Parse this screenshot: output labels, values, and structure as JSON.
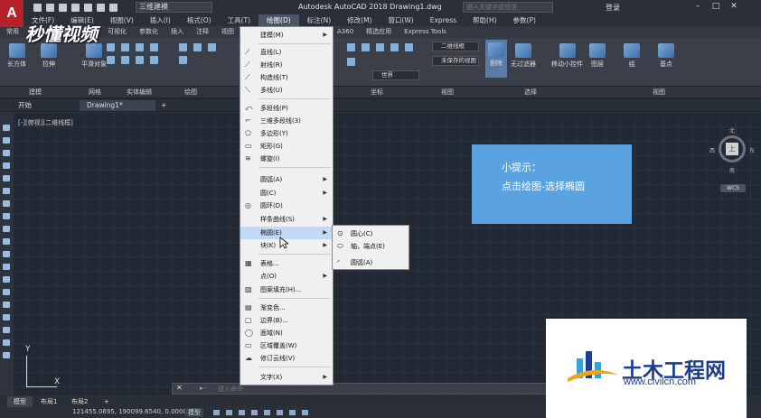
{
  "titlebar": {
    "app_logo": "A",
    "workspace": "三维建模",
    "app_title": "Autodesk AutoCAD 2018    Drawing1.dwg",
    "search_placeholder": "键入关键字或短语",
    "login": "登录"
  },
  "menubar": {
    "items": [
      "文件(F)",
      "编辑(E)",
      "视图(V)",
      "插入(I)",
      "格式(O)",
      "工具(T)",
      "绘图(D)",
      "标注(N)",
      "修改(M)",
      "窗口(W)",
      "Express",
      "帮助(H)",
      "参数(P)"
    ]
  },
  "ribbon_tabs": [
    "常用",
    "实体",
    "曲面",
    "网格",
    "可视化",
    "参数化",
    "插入",
    "注释",
    "视图",
    "A360",
    "精选应用",
    "Express Tools"
  ],
  "ribbon": {
    "buttons": {
      "box": "长方体",
      "extrude": "拉伸",
      "smooth": "平滑对象",
      "delete": "剔除",
      "no_filter": "无过滤器",
      "move_gizmo": "移动小控件",
      "layers": "图层",
      "group": "组",
      "base": "基点"
    },
    "visual_style": "二维线框",
    "view_dropdown": "未保存的视图",
    "ucs_dropdown": "世界",
    "panels": [
      "建模",
      "网格",
      "实体编辑",
      "绘图",
      "坐标",
      "视图",
      "选择",
      "视图"
    ]
  },
  "doc_tabs": [
    "开始",
    "Drawing1*"
  ],
  "viewport_label": "[-][俯视][二维线框]",
  "navcube": {
    "north": "北",
    "south": "南",
    "east": "东",
    "west": "西",
    "face": "上",
    "wcs": "WCS"
  },
  "tip": {
    "title": "小提示：",
    "text": "点击绘图-选择椭圆"
  },
  "draw_menu": {
    "items": [
      {
        "label": "建模(M)",
        "arrow": true,
        "icon": ""
      },
      {
        "label": "直线(L)",
        "arrow": false,
        "icon": "line-icon"
      },
      {
        "label": "射线(R)",
        "arrow": false,
        "icon": "ray-icon"
      },
      {
        "label": "构造线(T)",
        "arrow": false,
        "icon": "xline-icon"
      },
      {
        "label": "多线(U)",
        "arrow": false,
        "icon": "mline-icon"
      },
      {
        "label": "多段线(P)",
        "arrow": false,
        "icon": "polyline-icon"
      },
      {
        "label": "三维多段线(3)",
        "arrow": false,
        "icon": "3dpoly-icon"
      },
      {
        "label": "多边形(Y)",
        "arrow": false,
        "icon": "polygon-icon"
      },
      {
        "label": "矩形(G)",
        "arrow": false,
        "icon": "rectangle-icon"
      },
      {
        "label": "螺旋(I)",
        "arrow": false,
        "icon": "helix-icon"
      },
      {
        "label": "圆弧(A)",
        "arrow": true,
        "icon": ""
      },
      {
        "label": "圆(C)",
        "arrow": true,
        "icon": ""
      },
      {
        "label": "圆环(D)",
        "arrow": false,
        "icon": "donut-icon"
      },
      {
        "label": "样条曲线(S)",
        "arrow": true,
        "icon": ""
      },
      {
        "label": "椭圆(E)",
        "arrow": true,
        "icon": ""
      },
      {
        "label": "块(K)",
        "arrow": true,
        "icon": ""
      },
      {
        "label": "表格...",
        "arrow": false,
        "icon": "table-icon"
      },
      {
        "label": "点(O)",
        "arrow": true,
        "icon": ""
      },
      {
        "label": "图案填充(H)...",
        "arrow": false,
        "icon": "hatch-icon"
      },
      {
        "label": "渐变色...",
        "arrow": false,
        "icon": "gradient-icon"
      },
      {
        "label": "边界(B)...",
        "arrow": false,
        "icon": "boundary-icon"
      },
      {
        "label": "面域(N)",
        "arrow": false,
        "icon": "region-icon"
      },
      {
        "label": "区域覆盖(W)",
        "arrow": false,
        "icon": "wipeout-icon"
      },
      {
        "label": "修订云线(V)",
        "arrow": false,
        "icon": "revcloud-icon"
      },
      {
        "label": "文字(X)",
        "arrow": true,
        "icon": ""
      }
    ]
  },
  "ellipse_submenu": {
    "items": [
      "圆心(C)",
      "轴，端点(E)",
      "圆弧(A)"
    ]
  },
  "cmdline": {
    "placeholder": "键入命令"
  },
  "ucs": {
    "x": "X",
    "y": "Y"
  },
  "layout_tabs": [
    "模型",
    "布局1",
    "布局2"
  ],
  "statusbar": {
    "coords": "121455.0695, 190099.6540, 0.0000",
    "mode": "模型"
  },
  "watermark_top": "秒懂视频",
  "watermark_bottom": {
    "name": "土木工程网",
    "url": "www.civilcn.com"
  }
}
